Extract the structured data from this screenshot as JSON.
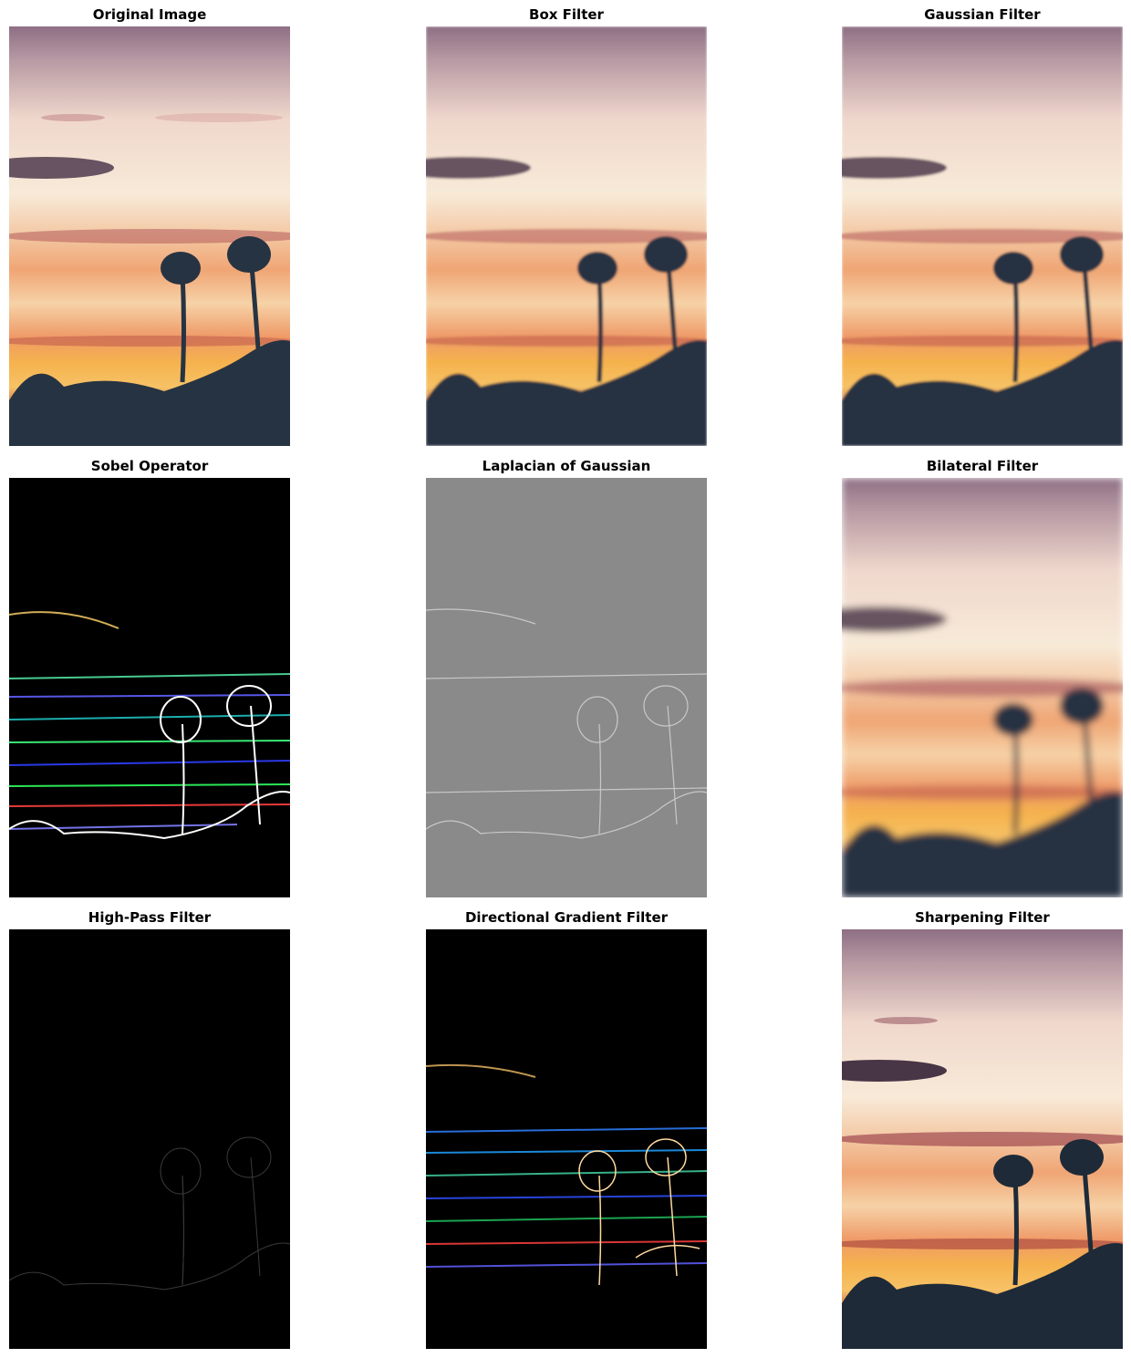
{
  "panels": [
    {
      "title": "Original Image",
      "style": "normal"
    },
    {
      "title": "Box Filter",
      "style": "box"
    },
    {
      "title": "Gaussian Filter",
      "style": "gaussian"
    },
    {
      "title": "Sobel Operator",
      "style": "sobel"
    },
    {
      "title": "Laplacian of Gaussian",
      "style": "log"
    },
    {
      "title": "Bilateral Filter",
      "style": "bilateral"
    },
    {
      "title": "High-Pass Filter",
      "style": "highpass"
    },
    {
      "title": "Directional Gradient Filter",
      "style": "directional"
    },
    {
      "title": "Sharpening Filter",
      "style": "sharpen"
    }
  ],
  "colors": {
    "sky_top": "#8e6f84",
    "sky_mid": "#f6e3cf",
    "sunset_band": "#f2a060",
    "horizon_glow": "#f5b04a",
    "silhouette": "#263342",
    "log_gray": "#8a8a8a",
    "edge_black": "#000000"
  }
}
